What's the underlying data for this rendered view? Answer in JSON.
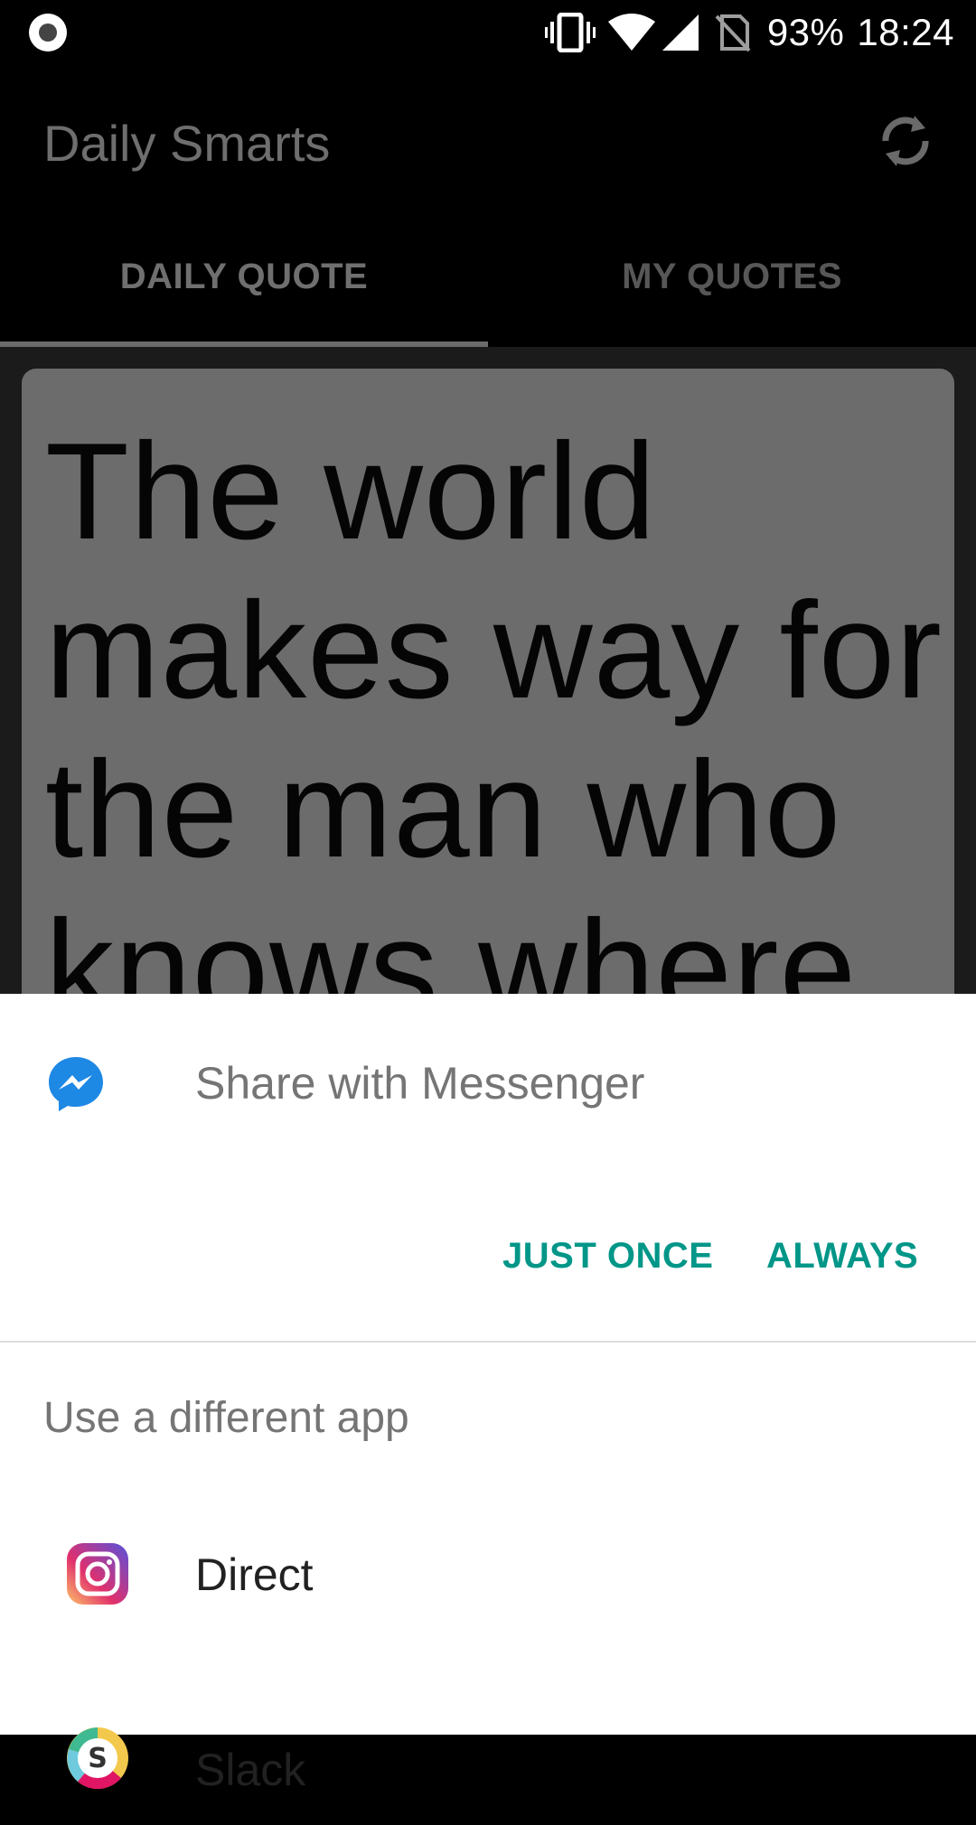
{
  "status_bar": {
    "battery": "93%",
    "time": "18:24",
    "icons": [
      "record-icon",
      "vibrate-icon",
      "wifi-icon",
      "signal-icon",
      "no-sim-icon"
    ]
  },
  "app_bar": {
    "title": "Daily Smarts",
    "refresh_icon": "refresh-icon",
    "tabs": [
      {
        "label": "DAILY QUOTE",
        "selected": true
      },
      {
        "label": "MY QUOTES",
        "selected": false
      }
    ]
  },
  "quote": {
    "text": "The world makes way for the man who knows where"
  },
  "share_sheet": {
    "default_app": {
      "icon": "messenger-icon",
      "label": "Share with Messenger"
    },
    "buttons": {
      "just_once": "JUST ONCE",
      "always": "ALWAYS"
    },
    "other_header": "Use a different app",
    "apps": [
      {
        "icon": "instagram-icon",
        "label": "Direct"
      },
      {
        "icon": "slack-icon",
        "label": "Slack"
      }
    ]
  },
  "colors": {
    "accent": "#009688",
    "scrim_text": "#6e6e6e",
    "card": "#6c6c6c"
  }
}
